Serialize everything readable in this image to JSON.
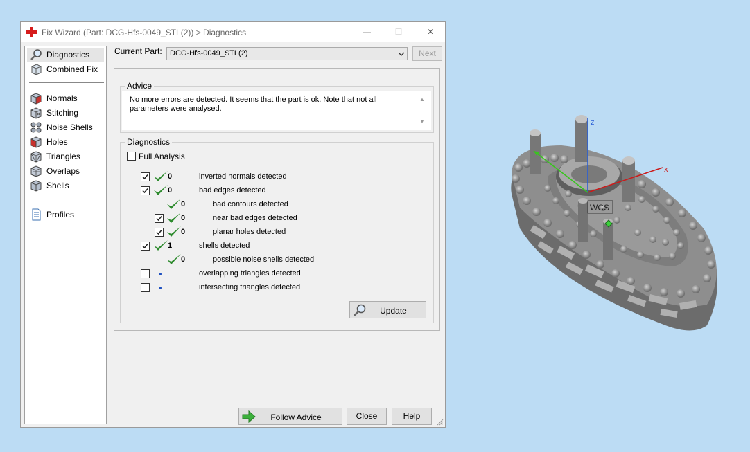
{
  "window": {
    "title": "Fix Wizard (Part: DCG-Hfs-0049_STL(2)) > Diagnostics",
    "controls": {
      "minimize": "—",
      "maximize": "☐",
      "close": "✕"
    }
  },
  "sidebar": {
    "items": [
      {
        "label": "Diagnostics",
        "icon": "magnifier-icon",
        "selected": true
      },
      {
        "label": "Combined Fix",
        "icon": "combined-fix-icon"
      },
      {
        "label": "Normals",
        "icon": "normals-cube-icon"
      },
      {
        "label": "Stitching",
        "icon": "stitching-cube-icon"
      },
      {
        "label": "Noise Shells",
        "icon": "noise-shells-cube-icon"
      },
      {
        "label": "Holes",
        "icon": "holes-cube-icon"
      },
      {
        "label": "Triangles",
        "icon": "triangles-cube-icon"
      },
      {
        "label": "Overlaps",
        "icon": "overlaps-cube-icon"
      },
      {
        "label": "Shells",
        "icon": "shells-cube-icon"
      },
      {
        "label": "Profiles",
        "icon": "profiles-document-icon"
      }
    ]
  },
  "current_part": {
    "label": "Current Part:",
    "value": "DCG-Hfs-0049_STL(2)"
  },
  "next_button": "Next",
  "advice": {
    "title": "Advice",
    "text": "No more errors are detected. It seems that the part is ok. Note that not all parameters were analysed."
  },
  "diagnostics": {
    "title": "Diagnostics",
    "full_analysis": {
      "label": "Full Analysis",
      "checked": false
    },
    "rows": [
      {
        "count": "0",
        "label": "inverted normals detected",
        "checked": true,
        "status": "ok"
      },
      {
        "count": "0",
        "label": "bad edges detected",
        "checked": true,
        "status": "ok"
      },
      {
        "count": "0",
        "label": "bad contours detected",
        "status": "ok"
      },
      {
        "count": "0",
        "label": "near bad edges detected",
        "checked": true,
        "status": "ok"
      },
      {
        "count": "0",
        "label": "planar holes detected",
        "checked": true,
        "status": "ok"
      },
      {
        "count": "1",
        "label": "shells detected",
        "checked": true,
        "status": "ok"
      },
      {
        "count": "0",
        "label": "possible noise shells detected",
        "status": "ok"
      },
      {
        "count": "",
        "label": "overlapping triangles detected",
        "checked": false,
        "status": "pending"
      },
      {
        "count": "",
        "label": "intersecting triangles detected",
        "checked": false,
        "status": "pending"
      }
    ],
    "update_button": "Update"
  },
  "buttons": {
    "follow_advice": "Follow Advice",
    "close": "Close",
    "help": "Help"
  },
  "viewport": {
    "axis_x": "x",
    "axis_z": "z",
    "wcs_label": "WCS",
    "colors": {
      "x_axis": "#cc1a1a",
      "y_axis": "#39c41f",
      "z_axis": "#2a5fd6",
      "model": "#8a8a8a",
      "background": "#bcdcf4"
    }
  },
  "colors": {
    "check_green": "#2e8b2e",
    "title_icon_red": "#d61c1c",
    "dot_blue": "#2052c0"
  }
}
